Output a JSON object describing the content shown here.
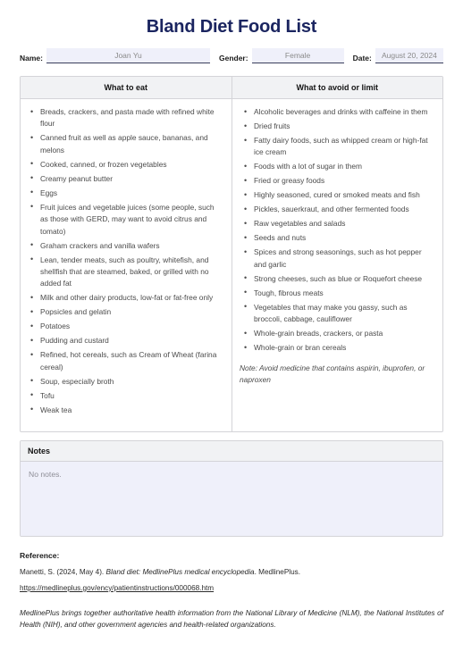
{
  "document": {
    "title": "Bland Diet Food List"
  },
  "identity": {
    "name_label": "Name:",
    "name_value": "Joan Yu",
    "gender_label": "Gender:",
    "gender_value": "Female",
    "date_label": "Date:",
    "date_value": "August 20, 2024"
  },
  "table": {
    "headers": [
      "What to eat",
      "What to avoid or limit"
    ],
    "eat": [
      "Breads, crackers, and pasta made with refined white flour",
      "Canned fruit as well as apple sauce, bananas, and melons",
      "Cooked, canned, or frozen vegetables",
      "Creamy peanut butter",
      "Eggs",
      "Fruit juices and vegetable juices (some people, such as those with GERD, may want to avoid citrus and tomato)",
      "Graham crackers and vanilla wafers",
      "Lean, tender meats, such as poultry, whitefish, and shellfish that are steamed, baked, or grilled with no added fat",
      "Milk and other dairy products, low-fat or fat-free only",
      "Popsicles and gelatin",
      "Potatoes",
      "Pudding and custard",
      "Refined, hot cereals, such as Cream of Wheat (farina cereal)",
      "Soup, especially broth",
      "Tofu",
      "Weak tea"
    ],
    "avoid": [
      "Alcoholic beverages and drinks with caffeine in them",
      "Dried fruits",
      "Fatty dairy foods, such as whipped cream or high-fat ice cream",
      "Foods with a lot of sugar in them",
      "Fried or greasy foods",
      "Highly seasoned, cured or smoked meats and fish",
      "Pickles, sauerkraut, and other fermented foods",
      "Raw vegetables and salads",
      "Seeds and nuts",
      "Spices and strong seasonings, such as hot pepper and garlic",
      "Strong cheeses, such as blue or Roquefort cheese",
      "Tough, fibrous meats",
      "Vegetables that may make you gassy, such as broccoli, cabbage, cauliflower",
      "Whole-grain breads, crackers, or pasta",
      "Whole-grain or bran cereals"
    ],
    "avoid_note": "Note: Avoid medicine that contains aspirin, ibuprofen, or naproxen"
  },
  "notes": {
    "header": "Notes",
    "body": "No notes."
  },
  "reference": {
    "heading": "Reference:",
    "citation_pre": "Manetti, S. (2024, May 4). ",
    "citation_italic": "Bland diet: MedlinePlus medical encyclopedia",
    "citation_post": ". MedlinePlus.",
    "link": "https://medlineplus.gov/ency/patientinstructions/000068.htm",
    "about": "MedlinePlus brings together authoritative health information from the National Library of Medicine (NLM), the National Institutes of Health (NIH), and other government agencies and health-related organizations."
  },
  "colors": {
    "title": "#1b2560",
    "field_fill": "#eff0fa",
    "header_band": "#f1f2f4",
    "border": "#d4d4d8"
  }
}
